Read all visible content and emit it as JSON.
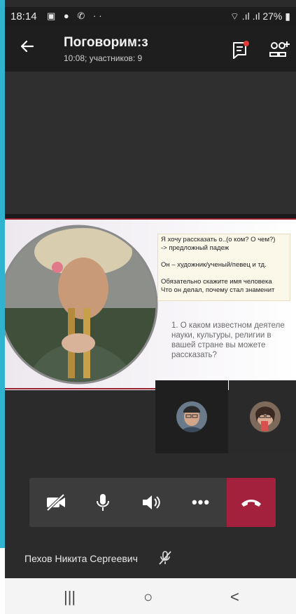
{
  "status_bar": {
    "time": "18:14",
    "battery": "27%"
  },
  "header": {
    "title": "Поговорим:з",
    "subtitle": "10:08; участников: 9"
  },
  "slide": {
    "note_lines": [
      "Я хочу рассказать о..(о ком? О чем?)",
      "-> предложный падеж",
      "Он – художник/ученый/певец  и тд.",
      "Обязательно скажите имя человека",
      "Что он делал, почему стал знаменит"
    ],
    "question": "1. О каком известном деятеле науки, культуры, религии в вашей стране вы можете рассказать?"
  },
  "controls": {
    "camera_icon": "camera-off-icon",
    "mic_icon": "microphone-icon",
    "speaker_icon": "speaker-icon",
    "more_label": "•••",
    "hangup_icon": "hangup-icon"
  },
  "participant": {
    "name": "Пехов Никита Сергеевич"
  },
  "navbar": {
    "recents": "|||",
    "home": "○",
    "back": "<"
  },
  "colors": {
    "accent": "#30b3cf",
    "hangup": "#a4213e",
    "background": "#2b2b2b"
  }
}
